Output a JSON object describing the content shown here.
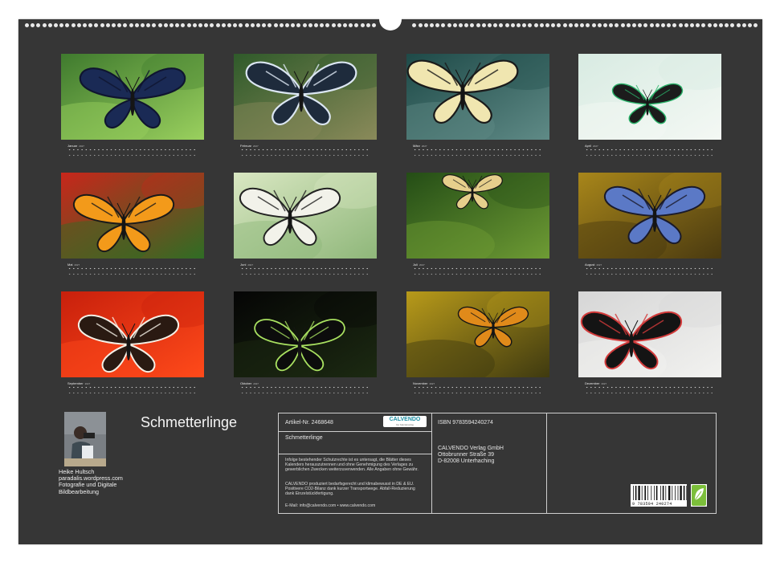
{
  "calendar": {
    "title": "Schmetterlinge",
    "year_label": "2027",
    "months": [
      {
        "name": "Januar",
        "image": "dark-blue-butterfly-on-green-leaf"
      },
      {
        "name": "Februar",
        "image": "blue-clipper-butterfly-on-fern"
      },
      {
        "name": "März",
        "image": "lime-swallowtail-butterfly"
      },
      {
        "name": "April",
        "image": "green-banded-swallowtail-on-white-flower"
      },
      {
        "name": "Mai",
        "image": "orange-tiger-butterfly-on-red-flower"
      },
      {
        "name": "Juni",
        "image": "paper-kite-butterfly-on-yellow-flower"
      },
      {
        "name": "Juli",
        "image": "swallowtail-above-fern"
      },
      {
        "name": "August",
        "image": "blue-morpho-butterfly"
      },
      {
        "name": "September",
        "image": "clipper-butterfly-on-red-dahlia"
      },
      {
        "name": "Oktober",
        "image": "jade-butterfly-on-dark-background"
      },
      {
        "name": "November",
        "image": "orange-butterfly-on-branch"
      },
      {
        "name": "Dezember",
        "image": "black-swallowtail-on-pale-flower"
      }
    ]
  },
  "author": {
    "name": "Heike Hultsch",
    "website": "paradalis.wordpress.com",
    "description": "Fotografie und  Digitale Bildbearbeitung"
  },
  "info": {
    "article_no": "Artikel-Nr. 2468648",
    "product_title": "Schmetterlinge",
    "legal_text": "Infolge bestehender Schutzrechte ist es untersagt, die Blätter dieses Kalenders herauszutrennen und ohne Genehmigung des Verlages zu gewerblichen Zwecken weiterzuverwenden. Alle Angaben ohne Gewähr.",
    "eco_text": "CALVENDO produziert bedarfsgerecht und klimabewusst in DE & EU. Positivere CO2-Bilanz dank kurzer Transportwege. Abfall-Reduzierung dank Einzelstückfertigung.",
    "contact": "E-Mail: info@calvendo.com • www.calvendo.com",
    "isbn": "ISBN 9783594240274",
    "publisher_line1": "CALVENDO Verlag GmbH",
    "publisher_line2": "Ottobrunner Straße 39",
    "publisher_line3": "D-82008 Unterhaching",
    "logo_text": "CALVENDO",
    "logo_subtext": "Der Kalenderverlag",
    "barcode_digits": "9 783594 240274"
  },
  "colors": {
    "sheet_background": "#363636",
    "text_primary": "#f4f4f4",
    "logo_accent": "#1d8fa3"
  }
}
